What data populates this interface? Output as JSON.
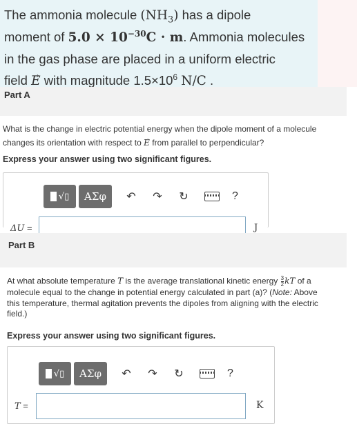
{
  "problem": {
    "line1_pre": "The ammonia molecule",
    "formula": "NH",
    "formula_sub": "3",
    "line1_post": "has a dipole",
    "line2_pre": "moment of",
    "moment_value": "5.0 × 10",
    "moment_exp": "−30",
    "moment_unit": "C · m",
    "line2_post": ". Ammonia molecules",
    "line3": "in the gas phase are placed in a uniform electric",
    "line4_pre": "field",
    "field_symbol": "E",
    "line4_mid": "with magnitude 1.5×10",
    "field_exp": "6",
    "field_unit": "N/C",
    "line4_end": "."
  },
  "part_a": {
    "label": "Part A",
    "question_l1_pre": "What is the change in electric potential energy when the dipole moment of a molecule",
    "question_l2_pre": "changes its orientation with respect to",
    "question_l2_sym": "E",
    "question_l2_post": "from parallel to perpendicular?",
    "instruction": "Express your answer using two significant figures.",
    "variable": "ΔU",
    "equals": "=",
    "unit": "J",
    "input_value": ""
  },
  "part_b": {
    "label": "Part B",
    "question_l1_pre": "At what absolute temperature",
    "question_l1_T": "T",
    "question_l1_mid": "is the average translational kinetic energy",
    "frac_num": "3",
    "frac_den": "2",
    "question_l1_kT": "kT",
    "question_l1_post": "of a",
    "question_l2": "molecule equal to the change in potential energy calculated in part (a)? (",
    "note_label": "Note:",
    "question_l2_post": " Above",
    "question_l3": "this temperature, thermal agitation prevents the dipoles from aligning with the electric",
    "question_l4": "field.)",
    "instruction": "Express your answer using two significant figures.",
    "variable": "T",
    "equals": "=",
    "unit": "K",
    "input_value": ""
  },
  "toolbar": {
    "templates_icon": "templates-icon",
    "greek_label": "ΑΣφ",
    "undo_icon": "undo-icon",
    "redo_icon": "redo-icon",
    "reset_icon": "reset-icon",
    "keyboard_icon": "keyboard-icon",
    "help_label": "?"
  },
  "colors": {
    "problem_bg": "#e8f4f7",
    "part_header_bg": "#f2f2f2",
    "toolbar_btn": "#6d6d6d",
    "input_border": "#7fa7c2"
  }
}
